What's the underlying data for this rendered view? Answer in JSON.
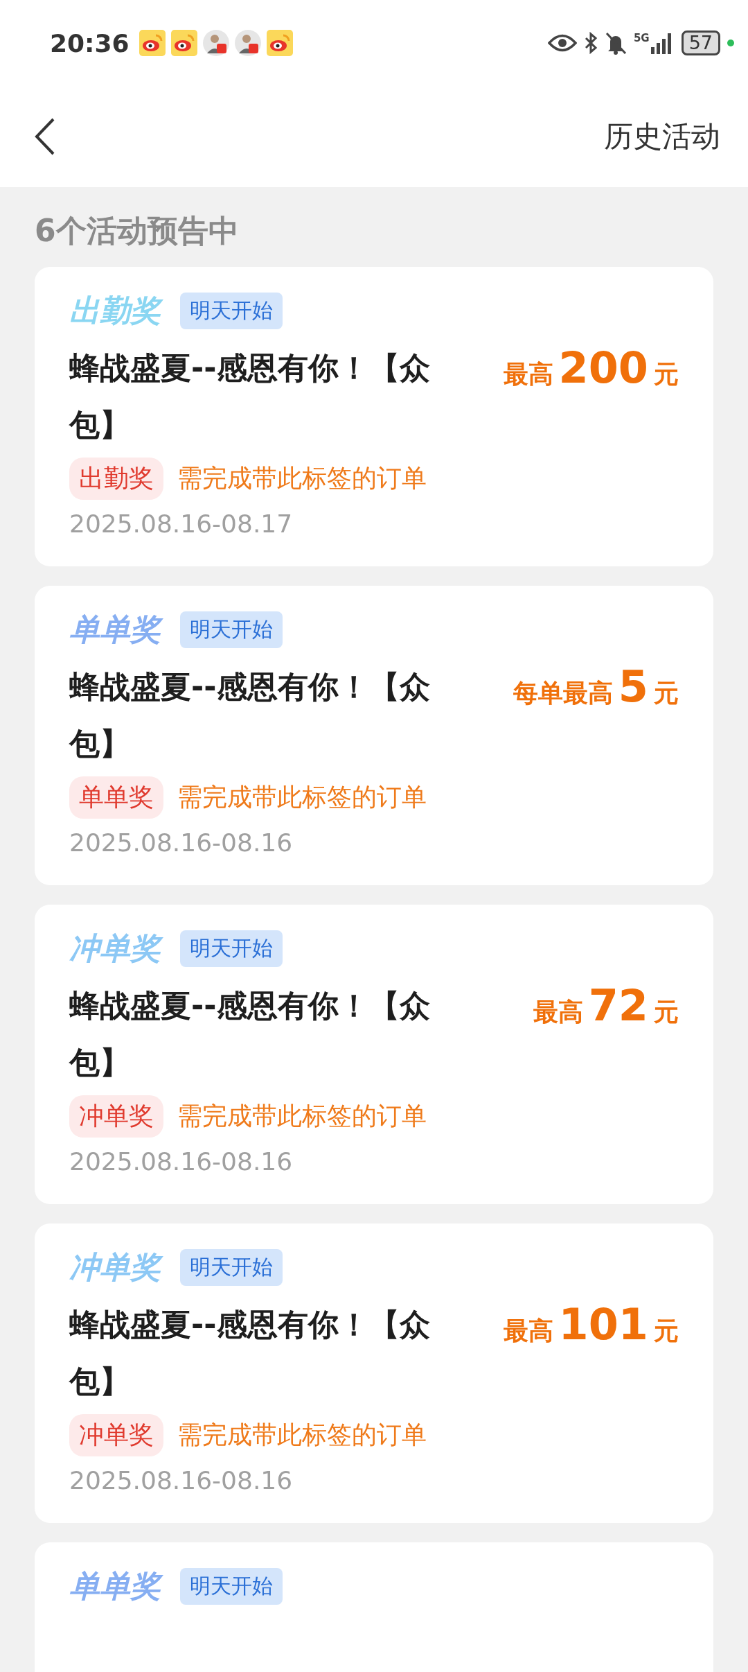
{
  "status_bar": {
    "time": "20:36",
    "notifications": [
      {
        "kind": "weibo"
      },
      {
        "kind": "weibo"
      },
      {
        "kind": "avatar"
      },
      {
        "kind": "avatar"
      },
      {
        "kind": "weibo"
      }
    ],
    "network": "5G",
    "battery": "57"
  },
  "header": {
    "action": "历史活动"
  },
  "section_title": "6个活动预告中",
  "cards": [
    {
      "label": "出勤奖",
      "color": "#8ad6f2",
      "status": "明天开始",
      "title": "蜂战盛夏--感恩有你！【众包】",
      "amount_prefix": "最高",
      "amount": "200",
      "amount_unit": "元",
      "tag": "出勤奖",
      "requirement": "需完成带此标签的订单",
      "dates": "2025.08.16-08.17"
    },
    {
      "label": "单单奖",
      "color": "#86aef2",
      "status": "明天开始",
      "title": "蜂战盛夏--感恩有你！【众包】",
      "amount_prefix": "每单最高",
      "amount": "5",
      "amount_unit": "元",
      "tag": "单单奖",
      "requirement": "需完成带此标签的订单",
      "dates": "2025.08.16-08.16"
    },
    {
      "label": "冲单奖",
      "color": "#8cc8f5",
      "status": "明天开始",
      "title": "蜂战盛夏--感恩有你！【众包】",
      "amount_prefix": "最高",
      "amount": "72",
      "amount_unit": "元",
      "tag": "冲单奖",
      "requirement": "需完成带此标签的订单",
      "dates": "2025.08.16-08.16"
    },
    {
      "label": "冲单奖",
      "color": "#8cc8f5",
      "status": "明天开始",
      "title": "蜂战盛夏--感恩有你！【众包】",
      "amount_prefix": "最高",
      "amount": "101",
      "amount_unit": "元",
      "tag": "冲单奖",
      "requirement": "需完成带此标签的订单",
      "dates": "2025.08.16-08.16"
    },
    {
      "label": "单单奖",
      "color": "#86aef2",
      "status": "明天开始"
    }
  ]
}
